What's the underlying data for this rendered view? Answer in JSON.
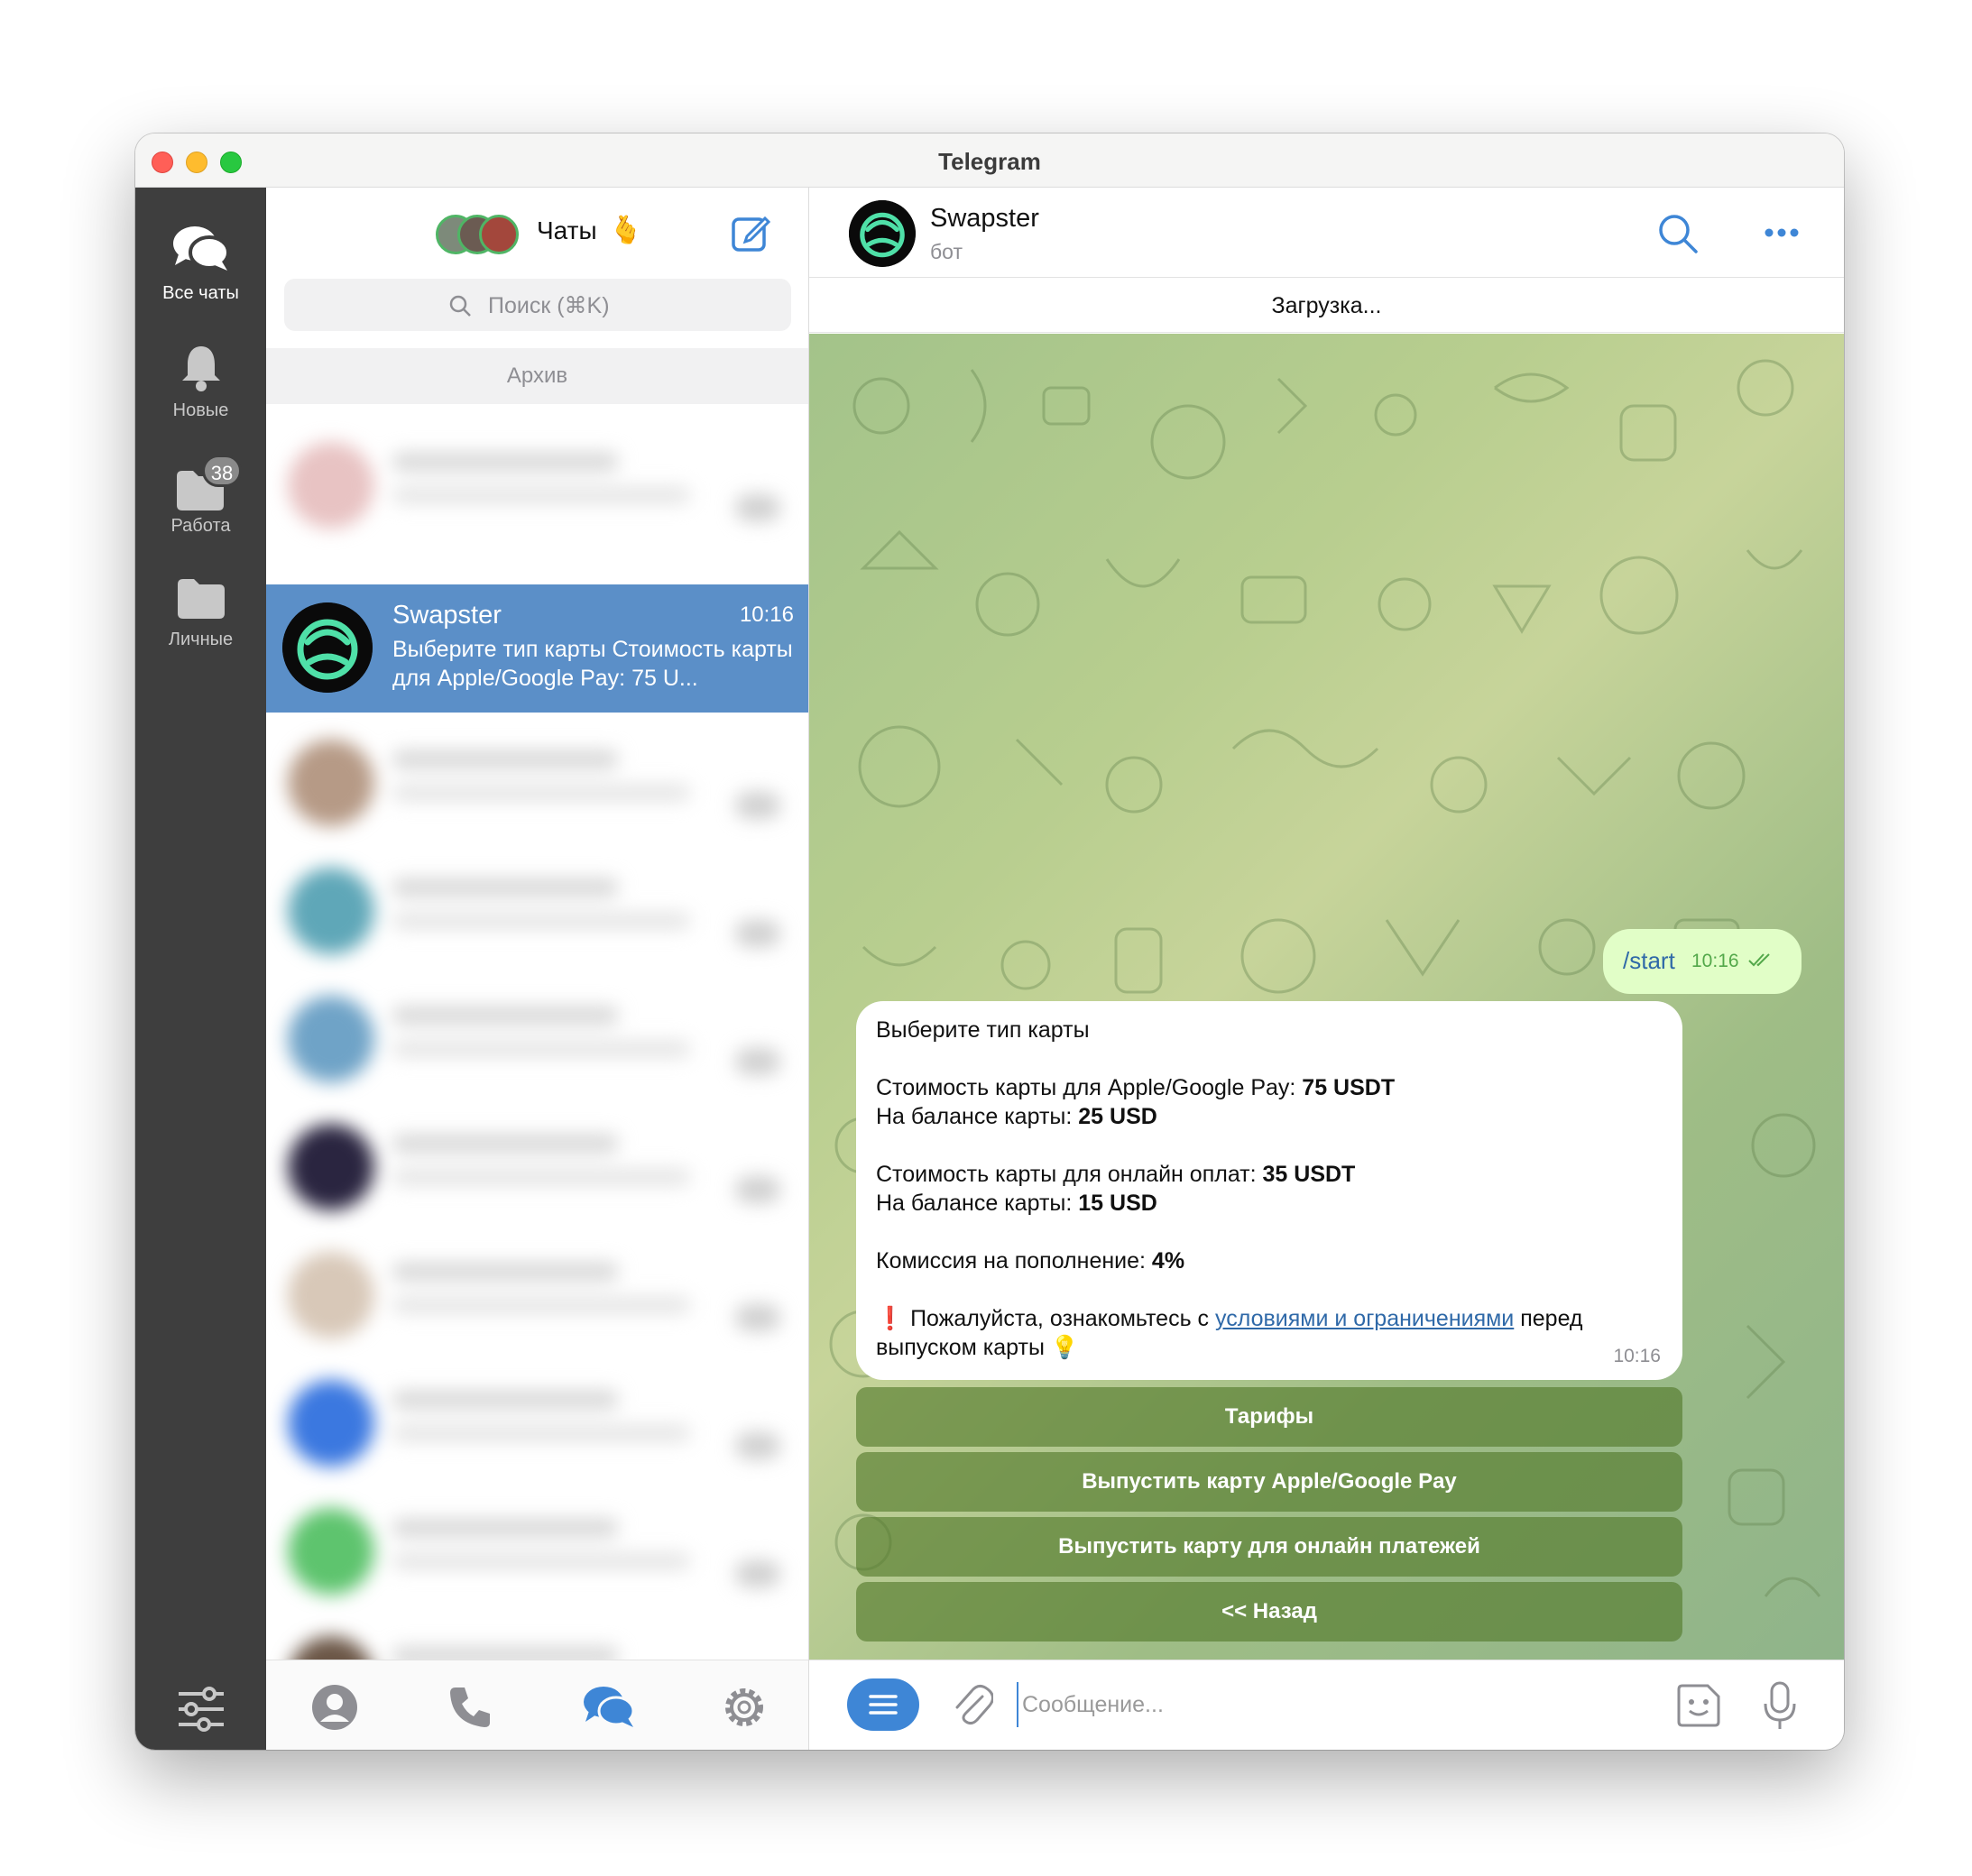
{
  "window": {
    "title": "Telegram"
  },
  "folders": {
    "items": [
      {
        "label": "Все чаты",
        "icon": "chats-icon",
        "active": true
      },
      {
        "label": "Новые",
        "icon": "bell-icon"
      },
      {
        "label": "Работа",
        "icon": "folder-icon",
        "badge": "38"
      },
      {
        "label": "Личные",
        "icon": "folder-icon"
      }
    ],
    "settings_icon": "sliders-icon"
  },
  "chatlist": {
    "title": "Чаты",
    "title_emoji": "🫰",
    "search_placeholder": "Поиск (⌘K)",
    "archive_label": "Архив",
    "active_chat": {
      "name": "Swapster",
      "time": "10:16",
      "preview": "Выберите тип карты  Стоимость карты для Apple/Google Pay: 75 U..."
    },
    "bottom_tabs": [
      "contacts-icon",
      "calls-icon",
      "chats-icon",
      "settings-icon"
    ]
  },
  "chat": {
    "name": "Swapster",
    "status": "бот",
    "loading": "Загрузка...",
    "outgoing": {
      "text": "/start",
      "time": "10:16"
    },
    "incoming": {
      "line1": "Выберите тип карты",
      "apple_label": "Стоимость карты для Apple/Google Pay: ",
      "apple_price": "75 USDT",
      "balance_label": "На балансе карты: ",
      "apple_balance": "25 USD",
      "online_label": "Стоимость карты для онлайн оплат: ",
      "online_price": "35 USDT",
      "online_balance": "15 USD",
      "fee_label": "Комиссия на пополнение: ",
      "fee_value": "4%",
      "warn_icon": "❗",
      "warn_before": " Пожалуйста, ознакомьтесь с ",
      "warn_link": "условиями и ограничениями",
      "warn_after": " перед выпуском карты ",
      "bulb": "💡",
      "time": "10:16"
    },
    "keyboard": [
      "Тарифы",
      "Выпустить карту Apple/Google Pay",
      "Выпустить карту для онлайн платежей",
      "<< Назад"
    ],
    "composer_placeholder": "Сообщение..."
  },
  "colors": {
    "accent": "#3e86d6",
    "active_chat_bg": "#5b8fc8",
    "folders_bg": "#3e3e3e",
    "outgoing_bubble": "#e1fec7",
    "swapster_green": "#4fe0a8"
  }
}
